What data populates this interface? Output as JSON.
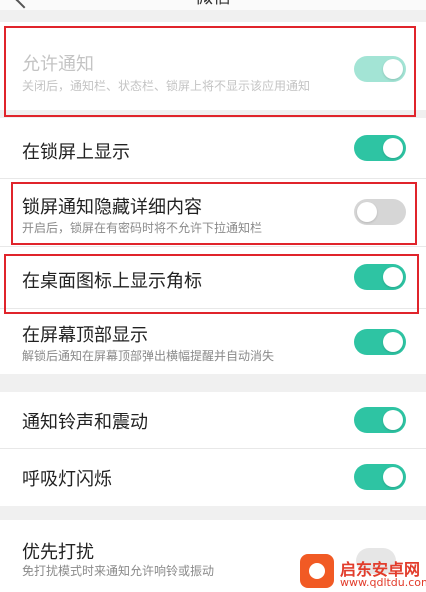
{
  "header": {
    "title": "微信"
  },
  "sections": {
    "allow": {
      "label": "允许通知",
      "desc": "关闭后，通知栏、状态栏、锁屏上将不显示该应用通知",
      "state": "on",
      "enabled": false
    },
    "lockscreen_show": {
      "label": "在锁屏上显示",
      "state": "on"
    },
    "lockscreen_hide": {
      "label": "锁屏通知隐藏详细内容",
      "desc": "开启后，锁屏在有密码时将不允许下拉通知栏",
      "state": "off"
    },
    "badge": {
      "label": "在桌面图标上显示角标",
      "state": "on"
    },
    "banner": {
      "label": "在屏幕顶部显示",
      "desc": "解锁后通知在屏幕顶部弹出横幅提醒并自动消失",
      "state": "on"
    },
    "sound": {
      "label": "通知铃声和震动",
      "state": "on"
    },
    "led": {
      "label": "呼吸灯闪烁",
      "state": "on"
    },
    "priority": {
      "label": "优先打扰",
      "desc": "免打扰模式时来通知允许响铃或振动"
    }
  },
  "watermark": {
    "name": "启东安卓网",
    "url": "www.qdltdu.com"
  },
  "colors": {
    "accent": "#2ec4a3",
    "highlight": "#e0242b",
    "toggle_off": "#d6d6d6"
  }
}
